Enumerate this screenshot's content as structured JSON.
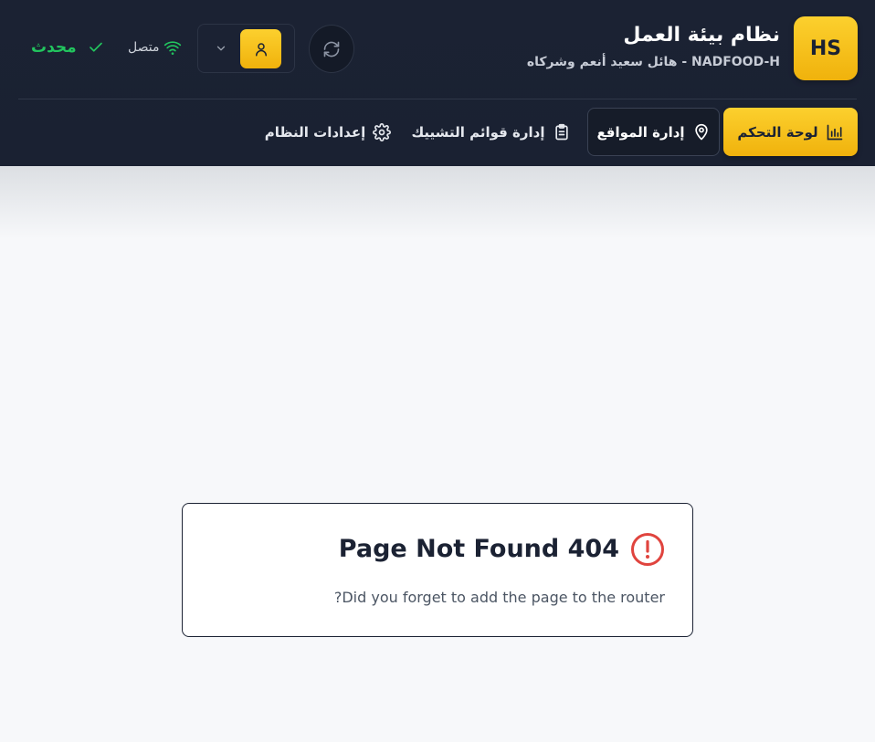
{
  "header": {
    "logo_text": "HS",
    "title": "نظام بيئة العمل",
    "subtitle": "NADFOOD-H - هائل سعيد أنعم وشركاه",
    "connection_label": "متصل",
    "status_label": "محدث"
  },
  "nav": {
    "items": [
      {
        "label": "لوحة التحكم",
        "icon": "bar-chart-icon",
        "active": true
      },
      {
        "label": "إدارة المواقع",
        "icon": "map-pin-icon",
        "active": false
      },
      {
        "label": "إدارة قوائم التشييك",
        "icon": "clipboard-icon",
        "active": false
      },
      {
        "label": "إعدادات النظام",
        "icon": "gear-icon",
        "active": false
      }
    ]
  },
  "error": {
    "title": "Page Not Found 404",
    "message": "?Did you forget to add the page to the router"
  },
  "colors": {
    "header_bg": "#1b2233",
    "accent": "#f5c211",
    "success": "#22c55e",
    "error": "#e0443e"
  }
}
